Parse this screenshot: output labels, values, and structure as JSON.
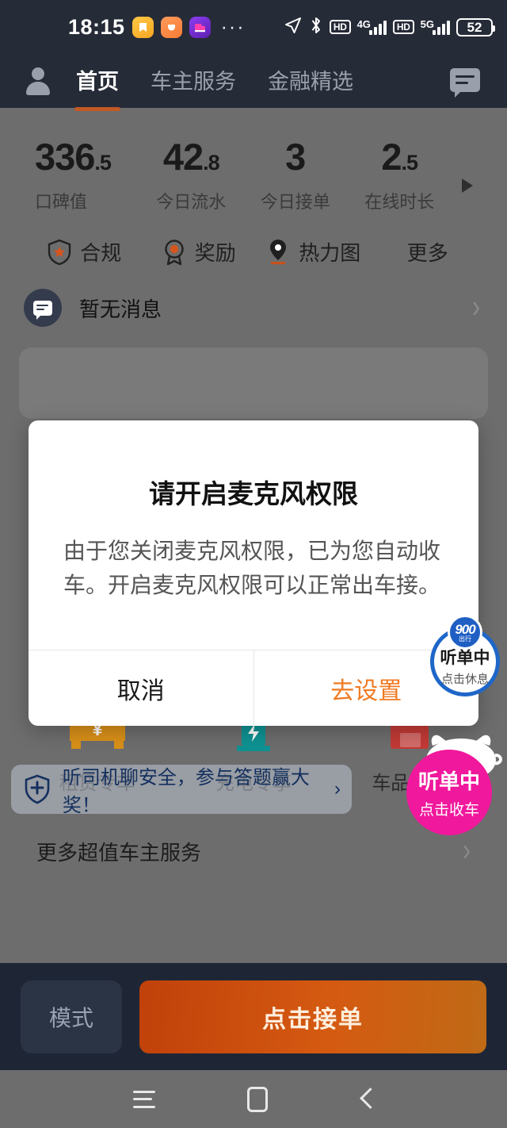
{
  "statusbar": {
    "time": "18:15",
    "overflow_dots": "···",
    "app_icons": [
      "notification-app-yellow",
      "notification-app-orange",
      "notification-app-purple"
    ],
    "icons": [
      "location-arrow-icon",
      "bluetooth-icon",
      "hd-icon",
      "signal-icon",
      "hd-icon",
      "signal-icon"
    ],
    "network1_label": "HD",
    "network1_gen": "4G",
    "network2_label": "HD",
    "network2_gen": "5G",
    "battery_level": "52"
  },
  "appbar": {
    "avatar": "user-avatar",
    "tabs": [
      {
        "label": "首页",
        "active": true
      },
      {
        "label": "车主服务",
        "active": false
      },
      {
        "label": "金融精选",
        "active": false
      }
    ],
    "message_icon": "message-icon"
  },
  "stats": [
    {
      "value": "336",
      "decimal": ".5",
      "label": "口碑值"
    },
    {
      "value": "42",
      "decimal": ".8",
      "label": "今日流水"
    },
    {
      "value": "3",
      "decimal": "",
      "label": "今日接单"
    },
    {
      "value": "2",
      "decimal": ".5",
      "label": "在线时长"
    }
  ],
  "quick_actions": [
    {
      "label": "合规",
      "icon": "shield-star-icon"
    },
    {
      "label": "奖励",
      "icon": "medal-icon"
    },
    {
      "label": "热力图",
      "icon": "location-pin-icon"
    },
    {
      "label": "更多",
      "icon": ""
    }
  ],
  "message_row": {
    "text": "暂无消息",
    "icon": "chat-bubble-icon",
    "chevron": "›"
  },
  "services": [
    {
      "label": "租赁专车",
      "icon": "car-yuan-icon",
      "color": "#d99018"
    },
    {
      "label": "充电专享",
      "icon": "charging-station-icon",
      "color": "#0f9292"
    },
    {
      "label": "车品商城",
      "icon": "shopping-bag-icon",
      "color": "#c23a36"
    }
  ],
  "banner": {
    "text": "听司机聊安全，参与答题赢大奖！",
    "icon": "shield-plus-icon",
    "chevron": "›"
  },
  "more_row": {
    "text": "更多超值车主服务",
    "chevron": "›"
  },
  "dialog": {
    "title": "请开启麦克风权限",
    "body": "由于您关闭麦克风权限，已为您自动收车。开启麦克风权限可以正常出车接。",
    "cancel_label": "取消",
    "confirm_label": "去设置",
    "confirm_color": "#f07a22"
  },
  "float_blue": {
    "badge_main": "900",
    "badge_sub": "出行",
    "line1": "听单中",
    "line2": "点击休息",
    "border_color": "#1e66c8"
  },
  "float_pink": {
    "line1": "听单中",
    "line2": "点击收车",
    "color": "#f0189c",
    "mascot": "pig-mascot"
  },
  "bottombar": {
    "mode_label": "模式",
    "accept_label": "点击接单",
    "accept_color": "#c94f10"
  },
  "navbar": {
    "recents": "recents-icon",
    "home": "home-icon",
    "back": "back-icon"
  }
}
